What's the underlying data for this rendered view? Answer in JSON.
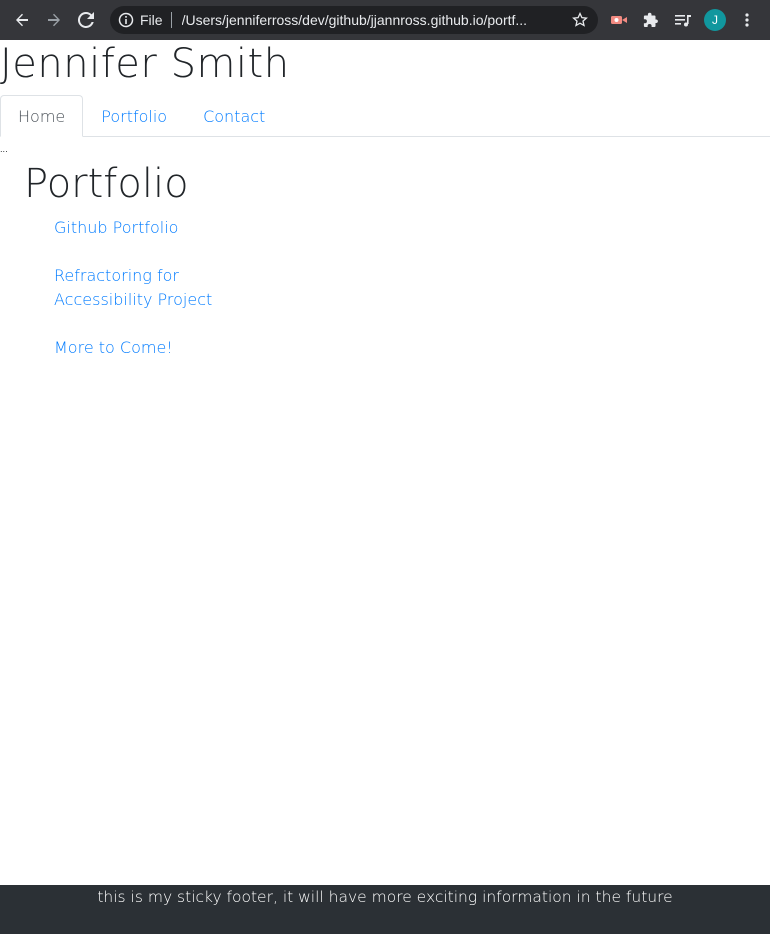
{
  "browser": {
    "scheme_label": "File",
    "url": "/Users/jenniferross/dev/github/jjannross.github.io/portf...",
    "profile_initial": "J",
    "profile_color": "#11979e"
  },
  "site": {
    "title": "Jennifer Smith"
  },
  "tabs": [
    {
      "label": "Home",
      "active": true
    },
    {
      "label": "Portfolio",
      "active": false
    },
    {
      "label": "Contact",
      "active": false
    }
  ],
  "stray_text": "...",
  "portfolio": {
    "heading": "Portfolio",
    "links": [
      {
        "label": "Github Portfolio"
      },
      {
        "label": "Refractoring for Accessibility Project"
      },
      {
        "label": "More to Come!"
      }
    ]
  },
  "footer": {
    "text": "this is my sticky footer, it will have more exciting information in the future"
  },
  "colors": {
    "link": "#007bff",
    "footer_bg": "#2b3035",
    "chrome_bg": "#35363a"
  }
}
